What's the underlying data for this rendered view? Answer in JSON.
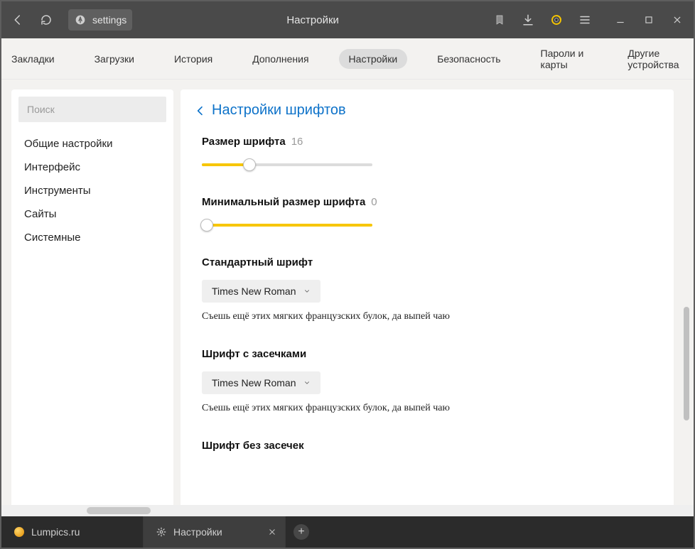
{
  "titlebar": {
    "url_text": "settings",
    "page_title": "Настройки"
  },
  "navtabs": {
    "items": [
      "Закладки",
      "Загрузки",
      "История",
      "Дополнения",
      "Настройки",
      "Безопасность",
      "Пароли и карты",
      "Другие устройства"
    ],
    "active_index": 4
  },
  "sidebar": {
    "search_placeholder": "Поиск",
    "items": [
      "Общие настройки",
      "Интерфейс",
      "Инструменты",
      "Сайты",
      "Системные"
    ]
  },
  "content": {
    "header": "Настройки шрифтов",
    "font_size": {
      "label": "Размер шрифта",
      "value": "16",
      "fill_pct": 28
    },
    "min_font_size": {
      "label": "Минимальный размер шрифта",
      "value": "0",
      "fill_pct": 100,
      "thumb_pct": 0
    },
    "standard_font": {
      "label": "Стандартный шрифт",
      "selected": "Times New Roman",
      "sample": "Съешь ещё этих мягких французских булок, да выпей чаю"
    },
    "serif_font": {
      "label": "Шрифт с засечками",
      "selected": "Times New Roman",
      "sample": "Съешь ещё этих мягких французских булок, да выпей чаю"
    },
    "sans_font": {
      "label": "Шрифт без засечек"
    }
  },
  "tabstrip": {
    "tabs": [
      {
        "label": "Lumpics.ru"
      },
      {
        "label": "Настройки"
      }
    ]
  }
}
